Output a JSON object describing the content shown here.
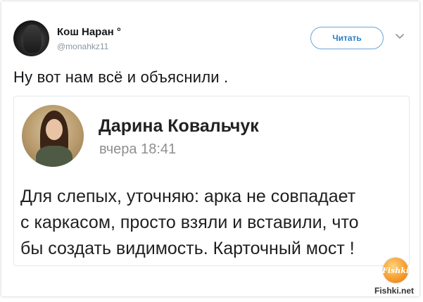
{
  "tweet": {
    "author_name": "Кош Наран °",
    "author_handle": "@monahkz11",
    "follow_label": "Читать",
    "text": "Ну вот нам всё и объяснили ."
  },
  "embedded_post": {
    "author_name": "Дарина Ковальчук",
    "timestamp": "вчера 18:41",
    "body_lines": [
      "Для слепых, уточняю: арка не совпадает",
      "с каркасом, просто взяли и вставили, что",
      "бы создать видимость. Карточный мост !"
    ]
  },
  "watermark": {
    "logo_text": "Fishki",
    "site": "Fishki.net"
  },
  "colors": {
    "follow_accent": "#2d80c7",
    "handle_gray": "#8a96a3",
    "watermark_orange": "#f59a2a"
  },
  "icons": {
    "menu": "chevron-down-icon"
  }
}
